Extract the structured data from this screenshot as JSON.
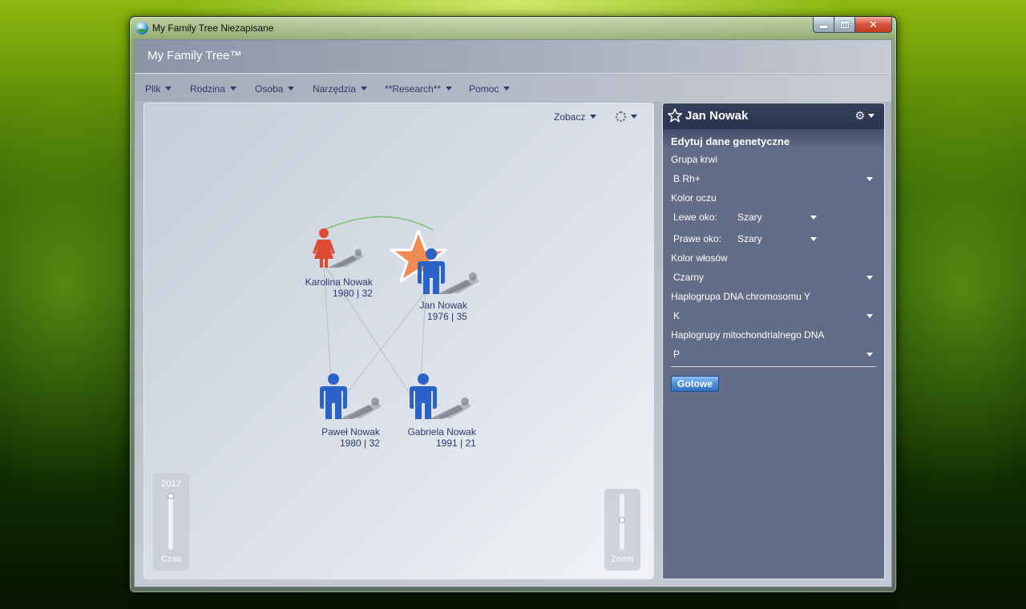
{
  "window": {
    "title": "My Family Tree Niezapisane"
  },
  "header": {
    "title": "My Family Tree™"
  },
  "menu": [
    "Plik",
    "Rodzina",
    "Osoba",
    "Narzędzia",
    "**Research**",
    "Pomoc"
  ],
  "canvas": {
    "view_label": "Zobacz",
    "people": [
      {
        "name": "Karolina Nowak",
        "info": "1980 | 32",
        "gender": "female",
        "selected": false
      },
      {
        "name": "Jan Nowak",
        "info": "1976 | 35",
        "gender": "male",
        "selected": true
      },
      {
        "name": "Paweł Nowak",
        "info": "1980 | 32",
        "gender": "male",
        "selected": false
      },
      {
        "name": "Gabriela Nowak",
        "info": "1991 | 21",
        "gender": "male",
        "selected": false
      }
    ],
    "time_slider": {
      "year": "2012",
      "label": "Czas"
    },
    "zoom_slider": {
      "label": "Zoom"
    }
  },
  "panel": {
    "person_name": "Jan Nowak",
    "section_title": "Edytuj dane genetyczne",
    "blood_group": {
      "label": "Grupa krwi",
      "value": "B Rh+"
    },
    "eye_color": {
      "label": "Kolor oczu",
      "left": {
        "label": "Lewe oko:",
        "value": "Szary"
      },
      "right": {
        "label": "Prawe oko:",
        "value": "Szary"
      }
    },
    "hair_color": {
      "label": "Kolor włosów",
      "value": "Czarny"
    },
    "y_dna": {
      "label": "Haplogrupa DNA chromosomu Y",
      "value": "K"
    },
    "mt_dna": {
      "label": "Haplogrupy mitochondrialnego DNA",
      "value": "P"
    },
    "done_label": "Gotowe"
  },
  "colors": {
    "male": "#2a62c9",
    "female": "#dd4b33",
    "selected_star": "#ee8a52",
    "spouse_link": "#79c26a",
    "panel_bg": "#636d87",
    "panel_header": "#2d3752"
  }
}
